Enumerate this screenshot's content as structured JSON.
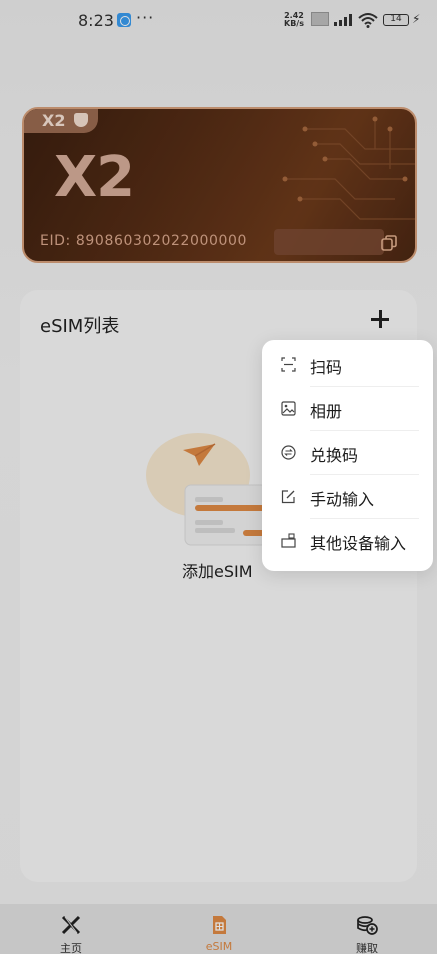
{
  "status_bar": {
    "time": "8:23",
    "dots": "···",
    "speed_value": "2.42",
    "speed_unit": "KB/s",
    "battery": "14"
  },
  "card": {
    "badge": "X2",
    "title": "X2",
    "eid_label": "EID: ",
    "eid_value": "890860302022000000",
    "colors": {
      "accent": "#d7a07b",
      "background": "#4b2713"
    }
  },
  "esim_list": {
    "title": "eSIM列表",
    "add_label": "添加eSIM"
  },
  "add_menu": {
    "items": [
      {
        "label": "扫码",
        "icon": "scan-icon"
      },
      {
        "label": "相册",
        "icon": "album-icon"
      },
      {
        "label": "兑换码",
        "icon": "redeem-code-icon"
      },
      {
        "label": "手动输入",
        "icon": "manual-input-icon"
      },
      {
        "label": "其他设备输入",
        "icon": "other-device-icon"
      }
    ]
  },
  "bottom_nav": {
    "home": "主页",
    "esim": "eSIM",
    "earn": "赚取",
    "active": "eSIM",
    "colors": {
      "active": "#e08a45"
    }
  }
}
